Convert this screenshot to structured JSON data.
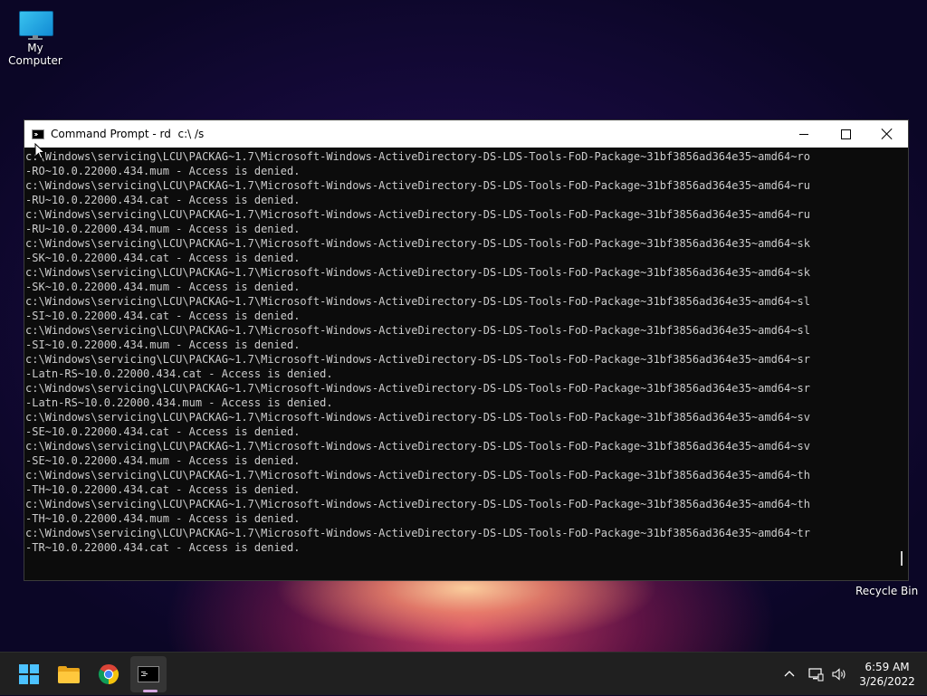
{
  "desktop": {
    "icons": [
      {
        "label": "My Computer"
      },
      {
        "label": "Recycle Bin"
      }
    ]
  },
  "window": {
    "title": "Command Prompt - rd  c:\\ /s",
    "lines": [
      "c:\\Windows\\servicing\\LCU\\PACKAG~1.7\\Microsoft-Windows-ActiveDirectory-DS-LDS-Tools-FoD-Package~31bf3856ad364e35~amd64~ro",
      "-RO~10.0.22000.434.mum - Access is denied.",
      "c:\\Windows\\servicing\\LCU\\PACKAG~1.7\\Microsoft-Windows-ActiveDirectory-DS-LDS-Tools-FoD-Package~31bf3856ad364e35~amd64~ru",
      "-RU~10.0.22000.434.cat - Access is denied.",
      "c:\\Windows\\servicing\\LCU\\PACKAG~1.7\\Microsoft-Windows-ActiveDirectory-DS-LDS-Tools-FoD-Package~31bf3856ad364e35~amd64~ru",
      "-RU~10.0.22000.434.mum - Access is denied.",
      "c:\\Windows\\servicing\\LCU\\PACKAG~1.7\\Microsoft-Windows-ActiveDirectory-DS-LDS-Tools-FoD-Package~31bf3856ad364e35~amd64~sk",
      "-SK~10.0.22000.434.cat - Access is denied.",
      "c:\\Windows\\servicing\\LCU\\PACKAG~1.7\\Microsoft-Windows-ActiveDirectory-DS-LDS-Tools-FoD-Package~31bf3856ad364e35~amd64~sk",
      "-SK~10.0.22000.434.mum - Access is denied.",
      "c:\\Windows\\servicing\\LCU\\PACKAG~1.7\\Microsoft-Windows-ActiveDirectory-DS-LDS-Tools-FoD-Package~31bf3856ad364e35~amd64~sl",
      "-SI~10.0.22000.434.cat - Access is denied.",
      "c:\\Windows\\servicing\\LCU\\PACKAG~1.7\\Microsoft-Windows-ActiveDirectory-DS-LDS-Tools-FoD-Package~31bf3856ad364e35~amd64~sl",
      "-SI~10.0.22000.434.mum - Access is denied.",
      "c:\\Windows\\servicing\\LCU\\PACKAG~1.7\\Microsoft-Windows-ActiveDirectory-DS-LDS-Tools-FoD-Package~31bf3856ad364e35~amd64~sr",
      "-Latn-RS~10.0.22000.434.cat - Access is denied.",
      "c:\\Windows\\servicing\\LCU\\PACKAG~1.7\\Microsoft-Windows-ActiveDirectory-DS-LDS-Tools-FoD-Package~31bf3856ad364e35~amd64~sr",
      "-Latn-RS~10.0.22000.434.mum - Access is denied.",
      "c:\\Windows\\servicing\\LCU\\PACKAG~1.7\\Microsoft-Windows-ActiveDirectory-DS-LDS-Tools-FoD-Package~31bf3856ad364e35~amd64~sv",
      "-SE~10.0.22000.434.cat - Access is denied.",
      "c:\\Windows\\servicing\\LCU\\PACKAG~1.7\\Microsoft-Windows-ActiveDirectory-DS-LDS-Tools-FoD-Package~31bf3856ad364e35~amd64~sv",
      "-SE~10.0.22000.434.mum - Access is denied.",
      "c:\\Windows\\servicing\\LCU\\PACKAG~1.7\\Microsoft-Windows-ActiveDirectory-DS-LDS-Tools-FoD-Package~31bf3856ad364e35~amd64~th",
      "-TH~10.0.22000.434.cat - Access is denied.",
      "c:\\Windows\\servicing\\LCU\\PACKAG~1.7\\Microsoft-Windows-ActiveDirectory-DS-LDS-Tools-FoD-Package~31bf3856ad364e35~amd64~th",
      "-TH~10.0.22000.434.mum - Access is denied.",
      "c:\\Windows\\servicing\\LCU\\PACKAG~1.7\\Microsoft-Windows-ActiveDirectory-DS-LDS-Tools-FoD-Package~31bf3856ad364e35~amd64~tr",
      "-TR~10.0.22000.434.cat - Access is denied."
    ]
  },
  "taskbar": {
    "buttons": [
      {
        "icon": "windows-start-icon"
      },
      {
        "icon": "file-explorer-icon"
      },
      {
        "icon": "chrome-icon"
      },
      {
        "icon": "command-prompt-icon"
      }
    ],
    "tray_icons": [
      "chevron-up-icon",
      "network-icon",
      "speaker-icon"
    ],
    "time": "6:59 AM",
    "date": "3/26/2022"
  },
  "colors": {
    "console_bg": "#0c0c0c",
    "console_text": "#cccccc",
    "taskbar_bg": "#202020",
    "accent": "#4cc2ff"
  }
}
